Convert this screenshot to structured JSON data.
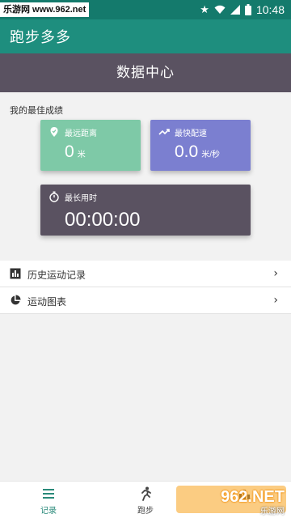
{
  "status_bar": {
    "watermark": "乐游网 www.962.net",
    "time": "10:48",
    "icons": [
      "star-icon",
      "wifi-icon",
      "signal-icon",
      "battery-icon"
    ]
  },
  "app_bar": {
    "title": "跑步多多"
  },
  "header": {
    "title": "数据中心"
  },
  "best": {
    "section_label": "我的最佳成绩",
    "distance": {
      "label": "最远距离",
      "value": "0",
      "unit": "米"
    },
    "speed": {
      "label": "最快配速",
      "value": "0.0",
      "unit": "米/秒"
    },
    "duration": {
      "label": "最长用时",
      "value": "00:00:00"
    }
  },
  "list": {
    "items": [
      {
        "label": "历史运动记录",
        "icon": "bar-chart-icon"
      },
      {
        "label": "运动图表",
        "icon": "pie-chart-icon"
      }
    ]
  },
  "bottom_nav": {
    "items": [
      {
        "label": "记录",
        "active": true
      },
      {
        "label": "跑步",
        "active": false
      }
    ]
  },
  "brand": {
    "logo_text": "962.NET",
    "sub_text": "乐游网"
  },
  "colors": {
    "status_bar": "#147a6c",
    "app_bar": "#1e8e7e",
    "header": "#5a5261",
    "card_distance": "#7ec9a7",
    "card_speed": "#7b7fd0",
    "card_time": "#5a5261",
    "nav_active": "#2a8a7a"
  }
}
